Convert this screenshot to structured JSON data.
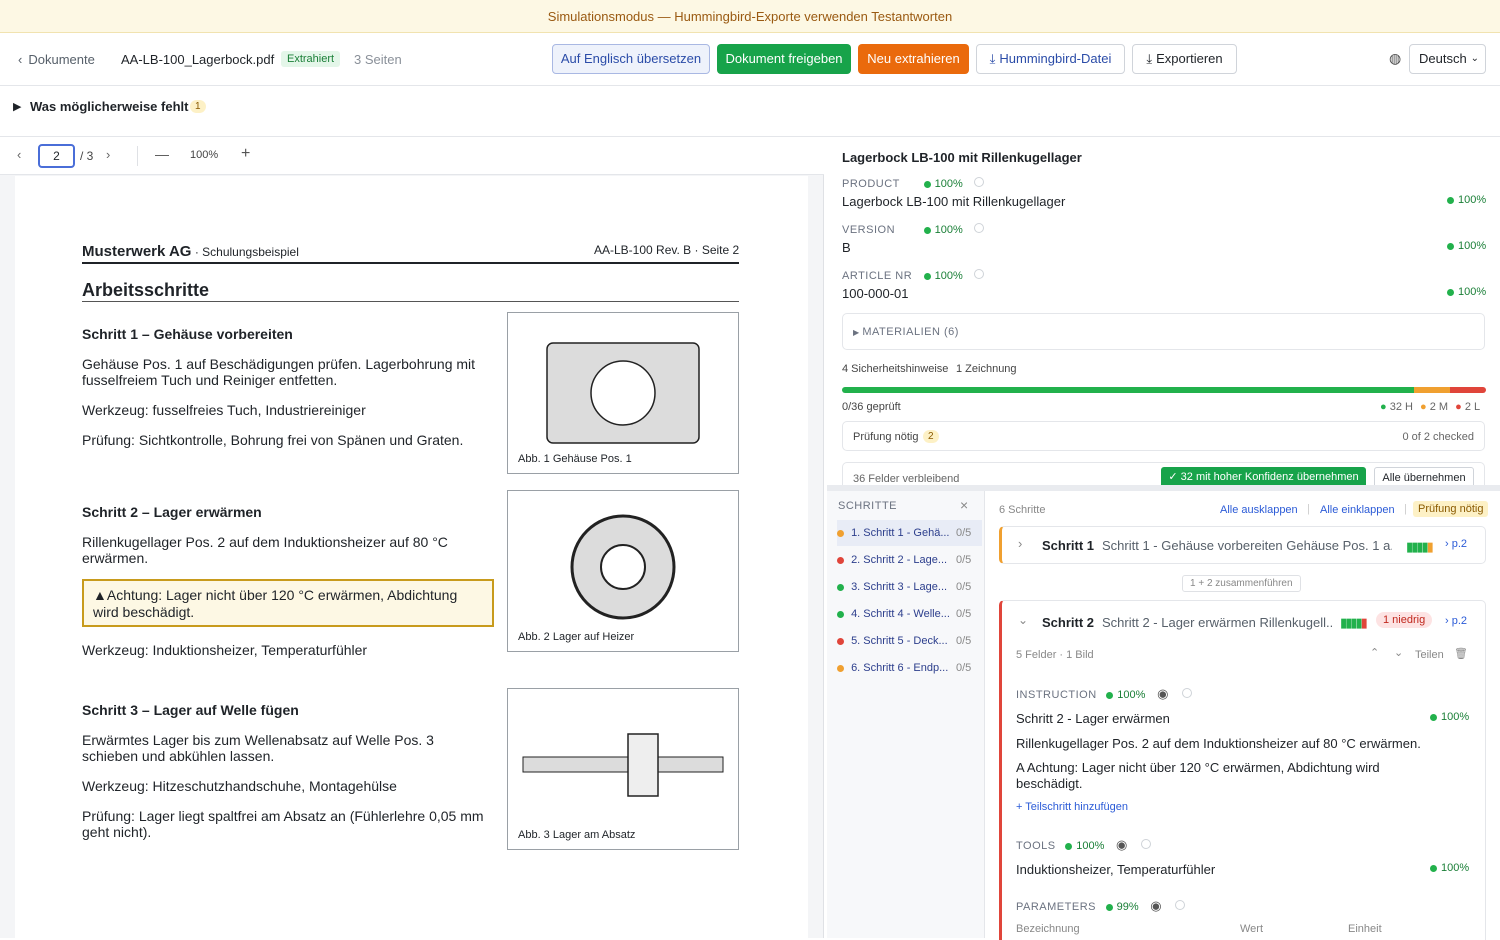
{
  "banner": "Simulationsmodus — Hummingbird-Exporte verwenden Testantworten",
  "topbar": {
    "back": "Dokumente",
    "filename": "AA-LB-100_Lagerbock.pdf",
    "status": "Extrahiert",
    "pages": "3 Seiten",
    "btn_translate": "Auf Englisch übersetzen",
    "btn_release": "Dokument freigeben",
    "btn_reextract": "Neu extrahieren",
    "btn_hummingbird": "Hummingbird-Datei",
    "btn_export": "Exportieren",
    "language": "Deutsch"
  },
  "missing": {
    "label": "Was möglicherweise fehlt",
    "count": "1"
  },
  "viewer": {
    "page": "2",
    "total": "/ 3",
    "zoom": "100%"
  },
  "doc": {
    "company": "Musterwerk AG",
    "company_sub": " · Schulungsbeispiel",
    "ref": "AA-LB-100 Rev. B · Seite 2",
    "section": "Arbeitsschritte",
    "s1_title": "Schritt 1 – Gehäuse vorbereiten",
    "s1_p1": "Gehäuse Pos. 1 auf Beschädigungen prüfen. Lagerbohrung mit fusselfreiem Tuch und Reiniger entfetten.",
    "s1_p2": "Werkzeug: fusselfreies Tuch, Industriereiniger",
    "s1_p3": "Prüfung: Sichtkontrolle, Bohrung frei von Spänen und Graten.",
    "fig1": "Abb. 1 Gehäuse Pos. 1",
    "s2_title": "Schritt 2 – Lager erwärmen",
    "s2_p1": "Rillenkugellager Pos. 2 auf dem Induktionsheizer auf 80 °C erwärmen.",
    "s2_warn": "Achtung: Lager nicht über 120 °C erwärmen, Abdichtung wird beschädigt.",
    "s2_p2": "Werkzeug: Induktionsheizer, Temperaturfühler",
    "fig2": "Abb. 2 Lager auf Heizer",
    "s3_title": "Schritt 3 – Lager auf Welle fügen",
    "s3_p1": "Erwärmtes Lager bis zum Wellenabsatz auf Welle Pos. 3 schieben und abkühlen lassen.",
    "s3_p2": "Werkzeug: Hitzeschutzhandschuhe, Montagehülse",
    "s3_p3": "Prüfung: Lager liegt spaltfrei am Absatz an (Fühlerlehre 0,05 mm geht nicht).",
    "fig3": "Abb. 3 Lager am Absatz"
  },
  "meta": {
    "title": "Lagerbock LB-100 mit Rillenkugellager",
    "fields": [
      {
        "label": "PRODUCT",
        "conf": "100%",
        "value": "Lagerbock LB-100 mit Rillenkugellager",
        "vconf": "100%"
      },
      {
        "label": "VERSION",
        "conf": "100%",
        "value": "B",
        "vconf": "100%"
      },
      {
        "label": "ARTICLE NR",
        "conf": "100%",
        "value": "100-000-01",
        "vconf": "100%"
      }
    ],
    "materials": "MATERIALIEN (6)",
    "safety": "4 Sicherheitshinweise",
    "drawings": "1 Zeichnung",
    "progress": {
      "high": 32,
      "medium": 2,
      "low": 2,
      "checked": "0/36 geprüft",
      "h": "32 H",
      "m": "2 M",
      "l": "2 L"
    },
    "review": "Prüfung nötig",
    "review_count": "2",
    "review_status": "0 of 2 checked",
    "remaining": "36 Felder verbleibend",
    "accept_high": "32 mit hoher Konfidenz übernehmen",
    "accept_all": "Alle übernehmen"
  },
  "steps_sidebar": {
    "title": "SCHRITTE",
    "items": [
      {
        "label": "1. Schritt 1 - Gehä...",
        "count": "0/5",
        "color": "#f0a030"
      },
      {
        "label": "2. Schritt 2 - Lage...",
        "count": "0/5",
        "color": "#e0453a"
      },
      {
        "label": "3. Schritt 3 - Lage...",
        "count": "0/5",
        "color": "#22b14c"
      },
      {
        "label": "4. Schritt 4 - Welle...",
        "count": "0/5",
        "color": "#22b14c"
      },
      {
        "label": "5. Schritt 5 - Deck...",
        "count": "0/5",
        "color": "#e0453a"
      },
      {
        "label": "6. Schritt 6 - Endp...",
        "count": "0/5",
        "color": "#f0a030"
      }
    ]
  },
  "steps": {
    "count": "6 Schritte",
    "expand": "Alle ausklappen",
    "collapse": "Alle einklappen",
    "review": "Prüfung nötig",
    "step1": {
      "name": "Schritt 1",
      "desc": "Schritt 1 - Gehäuse vorbereiten Gehäuse Pos. 1 a...",
      "page": "p.2"
    },
    "merge": "1 + 2 zusammenführen",
    "step2": {
      "name": "Schritt 2",
      "desc": "Schritt 2 - Lager erwärmen Rillenkugell...",
      "flag": "1 niedrig",
      "page": "p.2",
      "meta": "5 Felder · 1 Bild",
      "split": "Teilen",
      "instruction_label": "INSTRUCTION",
      "instruction_conf": "100%",
      "instr_title": "Schritt 2 - Lager erwärmen",
      "instr_title_conf": "100%",
      "instr_text": "Rillenkugellager Pos. 2 auf dem Induktionsheizer auf 80 °C erwärmen.",
      "instr_warn": "A Achtung: Lager nicht über 120 °C erwärmen, Abdichtung wird beschädigt.",
      "add_sub": "+ Teilschritt hinzufügen",
      "tools_label": "TOOLS",
      "tools_conf": "100%",
      "tools": "Induktionsheizer, Temperaturfühler",
      "tools_vconf": "100%",
      "params_label": "PARAMETERS",
      "params_conf": "99%",
      "col_name": "Bezeichnung",
      "col_value": "Wert",
      "col_unit": "Einheit"
    }
  }
}
